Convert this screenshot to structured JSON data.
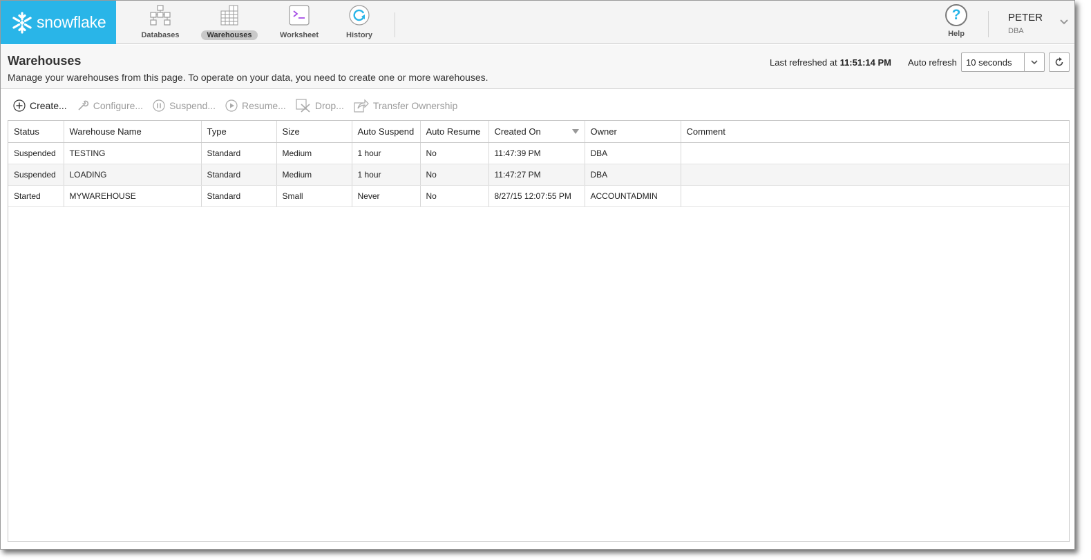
{
  "nav": {
    "logo_text": "snowflake",
    "items": [
      {
        "label": "Databases",
        "icon": "databases-icon"
      },
      {
        "label": "Warehouses",
        "icon": "warehouses-icon",
        "active": true
      },
      {
        "label": "Worksheet",
        "icon": "worksheet-icon"
      },
      {
        "label": "History",
        "icon": "history-icon"
      }
    ],
    "help_label": "Help",
    "user_name": "PETER",
    "user_role": "DBA"
  },
  "header": {
    "title": "Warehouses",
    "description": "Manage your warehouses from this page. To operate on your data, you need to create one or more warehouses.",
    "last_refreshed_label": "Last refreshed at",
    "last_refreshed_time": "11:51:14 PM",
    "auto_refresh_label": "Auto refresh",
    "auto_refresh_value": "10 seconds"
  },
  "toolbar": {
    "create": "Create...",
    "configure": "Configure...",
    "suspend": "Suspend...",
    "resume": "Resume...",
    "drop": "Drop...",
    "transfer": "Transfer Ownership"
  },
  "table": {
    "columns": [
      "Status",
      "Warehouse Name",
      "Type",
      "Size",
      "Auto Suspend",
      "Auto Resume",
      "Created On",
      "Owner",
      "Comment"
    ],
    "sorted_column": "Created On",
    "rows": [
      [
        "Suspended",
        "TESTING",
        "Standard",
        "Medium",
        "1 hour",
        "No",
        "11:47:39 PM",
        "DBA",
        ""
      ],
      [
        "Suspended",
        "LOADING",
        "Standard",
        "Medium",
        "1 hour",
        "No",
        "11:47:27 PM",
        "DBA",
        ""
      ],
      [
        "Started",
        "MYWAREHOUSE",
        "Standard",
        "Small",
        "Never",
        "No",
        "8/27/15 12:07:55 PM",
        "ACCOUNTADMIN",
        ""
      ]
    ]
  },
  "colors": {
    "brand": "#29b5e8",
    "worksheet_accent": "#a64ee5"
  }
}
